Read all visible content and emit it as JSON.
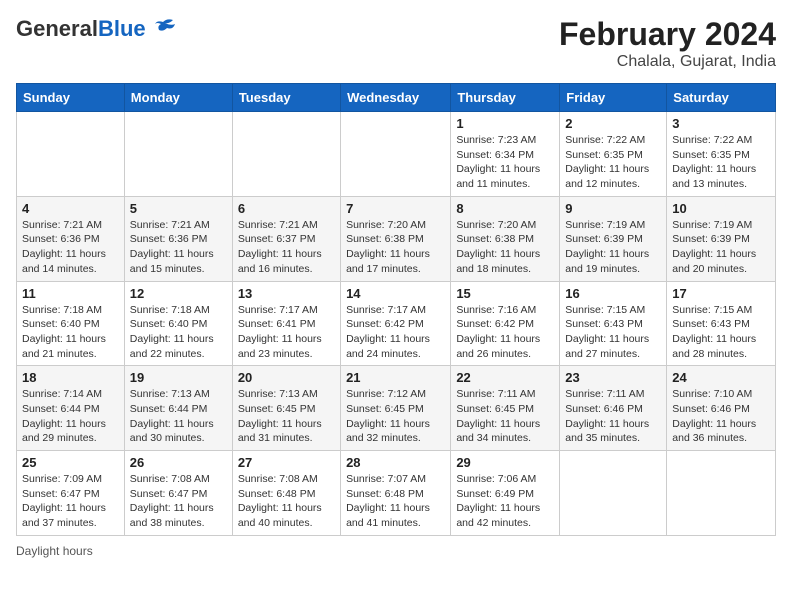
{
  "header": {
    "logo_general": "General",
    "logo_blue": "Blue",
    "title": "February 2024",
    "subtitle": "Chalala, Gujarat, India"
  },
  "days_of_week": [
    "Sunday",
    "Monday",
    "Tuesday",
    "Wednesday",
    "Thursday",
    "Friday",
    "Saturday"
  ],
  "weeks": [
    [
      {
        "day": "",
        "info": ""
      },
      {
        "day": "",
        "info": ""
      },
      {
        "day": "",
        "info": ""
      },
      {
        "day": "",
        "info": ""
      },
      {
        "day": "1",
        "info": "Sunrise: 7:23 AM\nSunset: 6:34 PM\nDaylight: 11 hours and 11 minutes."
      },
      {
        "day": "2",
        "info": "Sunrise: 7:22 AM\nSunset: 6:35 PM\nDaylight: 11 hours and 12 minutes."
      },
      {
        "day": "3",
        "info": "Sunrise: 7:22 AM\nSunset: 6:35 PM\nDaylight: 11 hours and 13 minutes."
      }
    ],
    [
      {
        "day": "4",
        "info": "Sunrise: 7:21 AM\nSunset: 6:36 PM\nDaylight: 11 hours and 14 minutes."
      },
      {
        "day": "5",
        "info": "Sunrise: 7:21 AM\nSunset: 6:36 PM\nDaylight: 11 hours and 15 minutes."
      },
      {
        "day": "6",
        "info": "Sunrise: 7:21 AM\nSunset: 6:37 PM\nDaylight: 11 hours and 16 minutes."
      },
      {
        "day": "7",
        "info": "Sunrise: 7:20 AM\nSunset: 6:38 PM\nDaylight: 11 hours and 17 minutes."
      },
      {
        "day": "8",
        "info": "Sunrise: 7:20 AM\nSunset: 6:38 PM\nDaylight: 11 hours and 18 minutes."
      },
      {
        "day": "9",
        "info": "Sunrise: 7:19 AM\nSunset: 6:39 PM\nDaylight: 11 hours and 19 minutes."
      },
      {
        "day": "10",
        "info": "Sunrise: 7:19 AM\nSunset: 6:39 PM\nDaylight: 11 hours and 20 minutes."
      }
    ],
    [
      {
        "day": "11",
        "info": "Sunrise: 7:18 AM\nSunset: 6:40 PM\nDaylight: 11 hours and 21 minutes."
      },
      {
        "day": "12",
        "info": "Sunrise: 7:18 AM\nSunset: 6:40 PM\nDaylight: 11 hours and 22 minutes."
      },
      {
        "day": "13",
        "info": "Sunrise: 7:17 AM\nSunset: 6:41 PM\nDaylight: 11 hours and 23 minutes."
      },
      {
        "day": "14",
        "info": "Sunrise: 7:17 AM\nSunset: 6:42 PM\nDaylight: 11 hours and 24 minutes."
      },
      {
        "day": "15",
        "info": "Sunrise: 7:16 AM\nSunset: 6:42 PM\nDaylight: 11 hours and 26 minutes."
      },
      {
        "day": "16",
        "info": "Sunrise: 7:15 AM\nSunset: 6:43 PM\nDaylight: 11 hours and 27 minutes."
      },
      {
        "day": "17",
        "info": "Sunrise: 7:15 AM\nSunset: 6:43 PM\nDaylight: 11 hours and 28 minutes."
      }
    ],
    [
      {
        "day": "18",
        "info": "Sunrise: 7:14 AM\nSunset: 6:44 PM\nDaylight: 11 hours and 29 minutes."
      },
      {
        "day": "19",
        "info": "Sunrise: 7:13 AM\nSunset: 6:44 PM\nDaylight: 11 hours and 30 minutes."
      },
      {
        "day": "20",
        "info": "Sunrise: 7:13 AM\nSunset: 6:45 PM\nDaylight: 11 hours and 31 minutes."
      },
      {
        "day": "21",
        "info": "Sunrise: 7:12 AM\nSunset: 6:45 PM\nDaylight: 11 hours and 32 minutes."
      },
      {
        "day": "22",
        "info": "Sunrise: 7:11 AM\nSunset: 6:45 PM\nDaylight: 11 hours and 34 minutes."
      },
      {
        "day": "23",
        "info": "Sunrise: 7:11 AM\nSunset: 6:46 PM\nDaylight: 11 hours and 35 minutes."
      },
      {
        "day": "24",
        "info": "Sunrise: 7:10 AM\nSunset: 6:46 PM\nDaylight: 11 hours and 36 minutes."
      }
    ],
    [
      {
        "day": "25",
        "info": "Sunrise: 7:09 AM\nSunset: 6:47 PM\nDaylight: 11 hours and 37 minutes."
      },
      {
        "day": "26",
        "info": "Sunrise: 7:08 AM\nSunset: 6:47 PM\nDaylight: 11 hours and 38 minutes."
      },
      {
        "day": "27",
        "info": "Sunrise: 7:08 AM\nSunset: 6:48 PM\nDaylight: 11 hours and 40 minutes."
      },
      {
        "day": "28",
        "info": "Sunrise: 7:07 AM\nSunset: 6:48 PM\nDaylight: 11 hours and 41 minutes."
      },
      {
        "day": "29",
        "info": "Sunrise: 7:06 AM\nSunset: 6:49 PM\nDaylight: 11 hours and 42 minutes."
      },
      {
        "day": "",
        "info": ""
      },
      {
        "day": "",
        "info": ""
      }
    ]
  ],
  "footer": "Daylight hours"
}
